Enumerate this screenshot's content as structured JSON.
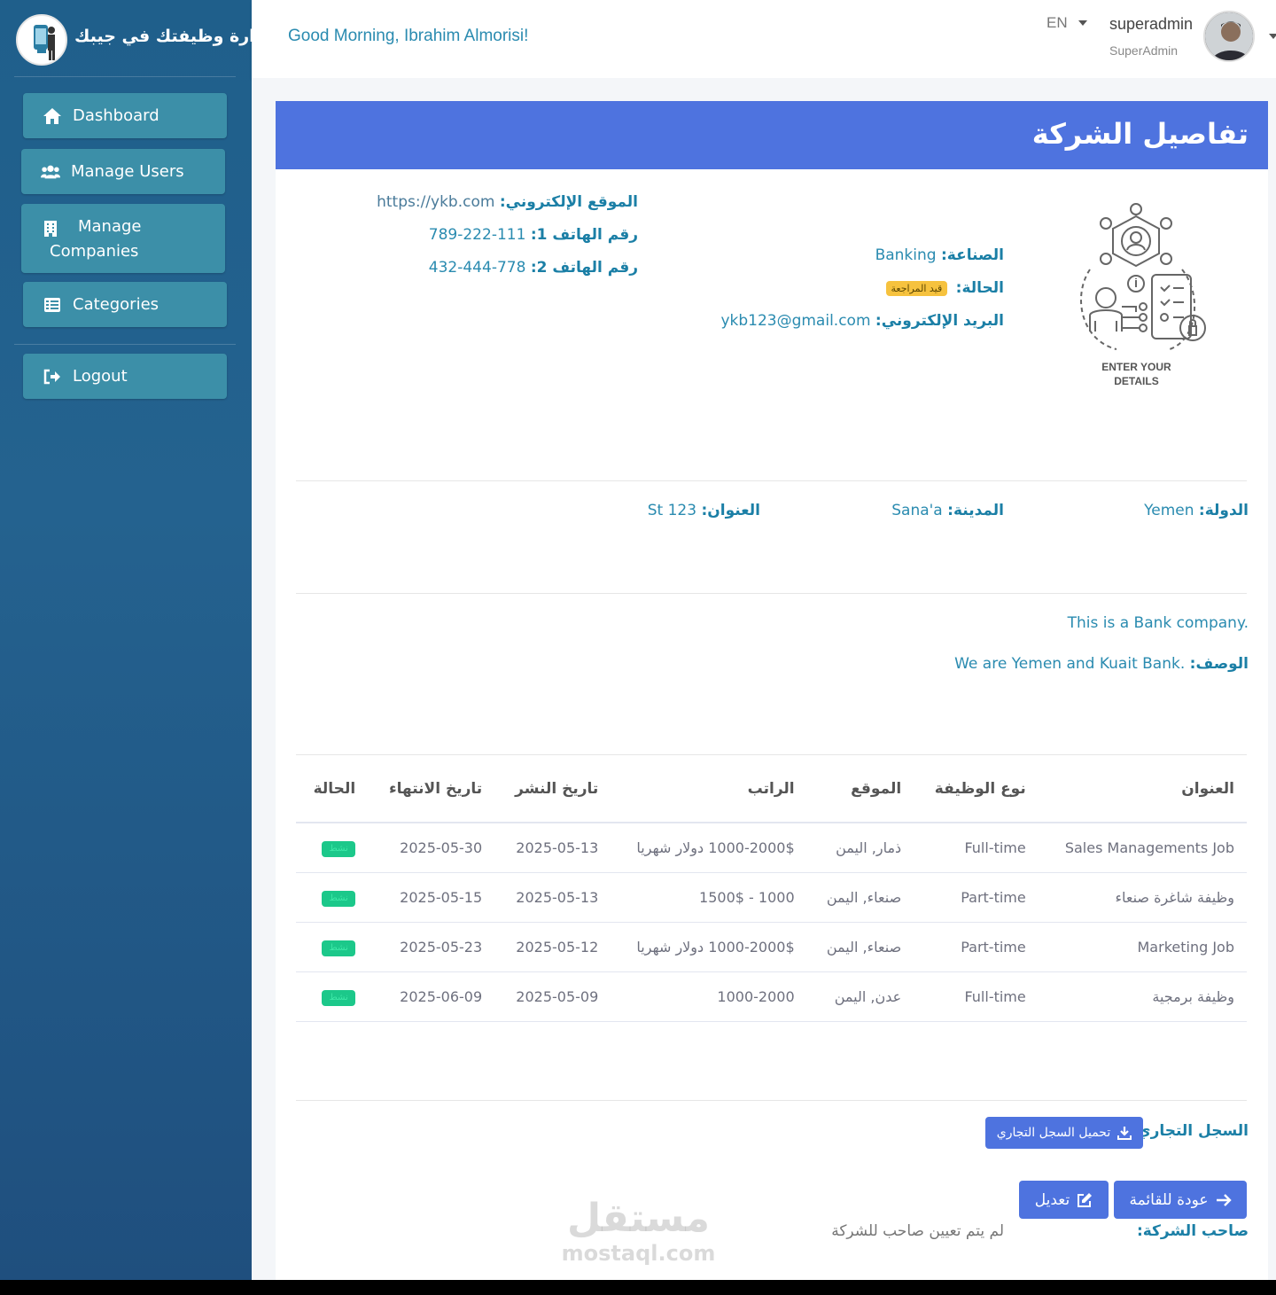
{
  "brand": {
    "title": "إدارة وظيفتك في جيبك"
  },
  "sidebar": {
    "items": [
      {
        "label": "Dashboard",
        "icon": "home-icon"
      },
      {
        "label": "Manage Users",
        "icon": "users-icon"
      },
      {
        "label": "Manage Companies",
        "label_line1": "Manage",
        "label_line2": "Companies",
        "icon": "building-icon"
      },
      {
        "label": "Categories",
        "icon": "list-icon"
      }
    ],
    "logout": {
      "label": "Logout",
      "icon": "logout-icon"
    }
  },
  "topbar": {
    "greeting": "Good Morning, Ibrahim Almorisi!",
    "language": "EN",
    "username": "superadmin",
    "role": "SuperAdmin"
  },
  "card": {
    "title": "تفاصيل الشركة"
  },
  "details": {
    "industry_label": "الصناعة:",
    "industry_value": "Banking",
    "status_label": "الحالة:",
    "status_value": "قيد المراجعة",
    "email_label": "البريد الإلكتروني:",
    "email_value": "ykb123@gmail.com",
    "website_label": "الموقع الإلكتروني:",
    "website_value": "https://ykb.com",
    "phone1_label": "رقم الهاتف 1:",
    "phone1_value": "111-222-789",
    "phone2_label": "رقم الهاتف 2:",
    "phone2_value": "778-444-432",
    "illustration_caption_1": "ENTER YOUR",
    "illustration_caption_2": "DETAILS"
  },
  "address": {
    "country_label": "الدولة:",
    "country_value": "Yemen",
    "city_label": "المدينة:",
    "city_value": "Sana'a",
    "address_label": "العنوان:",
    "address_value": "St 123"
  },
  "description": {
    "text1": "This is a Bank company.",
    "label": "الوصف:",
    "text2": "We are Yemen and Kuait Bank."
  },
  "jobs_table": {
    "headers": [
      "العنوان",
      "نوع الوظيفة",
      "الموقع",
      "الراتب",
      "تاريخ النشر",
      "تاريخ الانتهاء",
      "الحالة"
    ],
    "rows": [
      {
        "title": "Sales Managements Job",
        "type": "Full-time",
        "location": "ذمار, اليمن",
        "salary": "1000-2000$ دولار شهريا",
        "posted": "2025-05-13",
        "expires": "2025-05-30",
        "status": "نشط"
      },
      {
        "title": "وظيفة شاغرة صنعاء",
        "type": "Part-time",
        "location": "صنعاء, اليمن",
        "salary": "1000 - 1500$",
        "posted": "2025-05-13",
        "expires": "2025-05-15",
        "status": "نشط"
      },
      {
        "title": "Marketing Job",
        "type": "Part-time",
        "location": "صنعاء, اليمن",
        "salary": "1000-2000$ دولار شهريا",
        "posted": "2025-05-12",
        "expires": "2025-05-23",
        "status": "نشط"
      },
      {
        "title": "وظيفة برمجية",
        "type": "Full-time",
        "location": "عدن, اليمن",
        "salary": "1000-2000",
        "posted": "2025-05-09",
        "expires": "2025-06-09",
        "status": "نشط"
      }
    ]
  },
  "commercial_register": {
    "label": "السجل التجاري:",
    "download_button": "تحميل السجل التجاري"
  },
  "actions": {
    "back_button": "عودة للقائمة",
    "edit_button": "تعديل"
  },
  "owner": {
    "label": "صاحب الشركة:",
    "value": "لم يتم تعيين صاحب للشركة"
  },
  "watermark": {
    "arabic": "مستقل",
    "latin": "mostaql.com"
  },
  "colors": {
    "sidebar": "#1f5f8b",
    "nav_button": "#3c8fa8",
    "primary": "#4e73df",
    "accent_text": "#2a8bb0",
    "pending_badge": "#f6c23e",
    "active_badge": "#1cc88a"
  }
}
